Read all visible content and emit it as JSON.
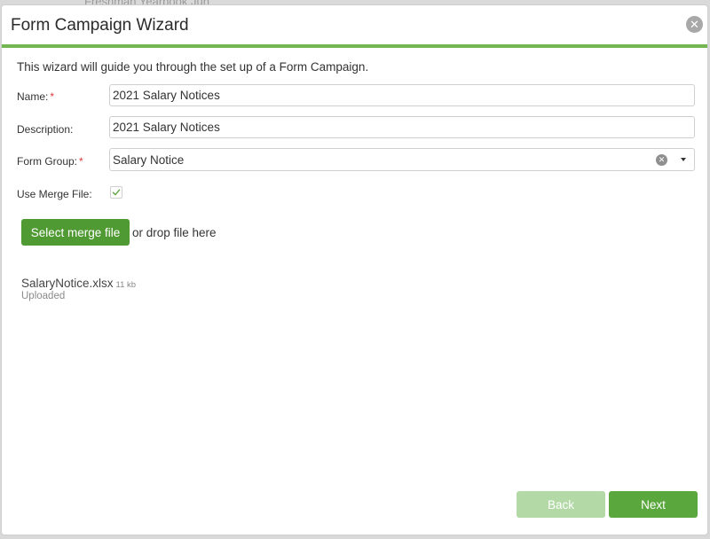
{
  "backdrop": {
    "partial_text": "Freshman Yearbook Jun"
  },
  "dialog": {
    "title": "Form Campaign Wizard",
    "close_icon": "close-icon",
    "close_glyph": "✕"
  },
  "form": {
    "intro": "This wizard will guide you through the set up of a Form Campaign.",
    "name_label": "Name:",
    "name_value": "2021 Salary Notices",
    "description_label": "Description:",
    "description_value": "2021 Salary Notices",
    "form_group_label": "Form Group:",
    "form_group_value": "Salary Notice",
    "required_marker": "*",
    "use_merge_file_label": "Use Merge File:",
    "use_merge_file_checked": true
  },
  "upload": {
    "button_label": "Select merge file",
    "drop_hint": "or drop file here",
    "file_name": "SalaryNotice.xlsx",
    "file_size": "11 kb",
    "file_status": "Uploaded"
  },
  "footer": {
    "back_label": "Back",
    "next_label": "Next"
  },
  "colors": {
    "accent_green": "#74b652",
    "button_green": "#4f9a33",
    "disabled_green": "#b3d9a6",
    "required_red": "#d93a3a"
  }
}
